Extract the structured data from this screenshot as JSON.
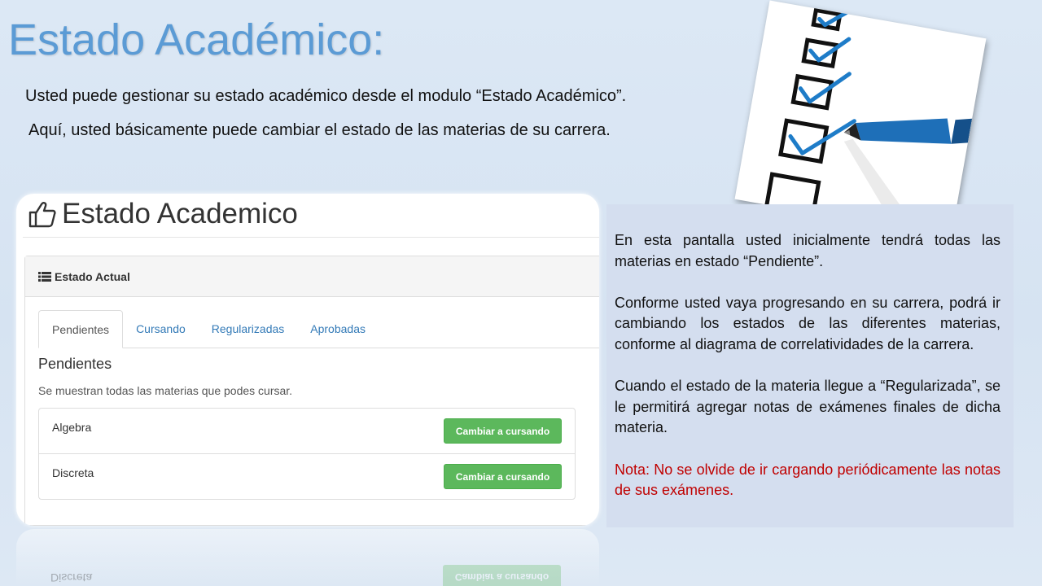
{
  "slide": {
    "title": "Estado Académico:",
    "intro_line_1": "Usted puede gestionar su estado académico desde el modulo “Estado Académico”.",
    "intro_line_2": "Aquí, usted básicamente puede cambiar el estado de las materias de su carrera."
  },
  "screenshot": {
    "page_title": "Estado Academico",
    "panel_heading": "Estado Actual",
    "tabs": [
      {
        "label": "Pendientes",
        "active": true
      },
      {
        "label": "Cursando",
        "active": false
      },
      {
        "label": "Regularizadas",
        "active": false
      },
      {
        "label": "Aprobadas",
        "active": false
      }
    ],
    "section_title": "Pendientes",
    "section_description": "Se muestran todas las materias que podes cursar.",
    "subjects": [
      {
        "name": "Algebra",
        "action_label": "Cambiar a cursando"
      },
      {
        "name": "Discreta",
        "action_label": "Cambiar a cursando"
      }
    ],
    "button_color": "#5cb85c",
    "link_color": "#337ab7"
  },
  "info_box": {
    "paragraph_1": "En esta pantalla usted inicialmente tendrá todas las materias en estado “Pendiente”.",
    "paragraph_2": "Conforme usted vaya progresando en su carrera, podrá ir cambiando los estados de las diferentes materias, conforme al diagrama de correlatividades de la carrera.",
    "paragraph_3": "Cuando el estado de la materia llegue a “Regularizada”, se le permitirá agregar notas de exámenes finales de dicha materia.",
    "note": "Nota: No se olvide de ir cargando periódicamente las notas de sus exámenes.",
    "note_color": "#c00000",
    "background_color": "#d4deef"
  },
  "illustration": {
    "icon": "checklist-with-pen-icon",
    "check_color": "#1e7cc8"
  },
  "title_color": "#5b9bd5"
}
